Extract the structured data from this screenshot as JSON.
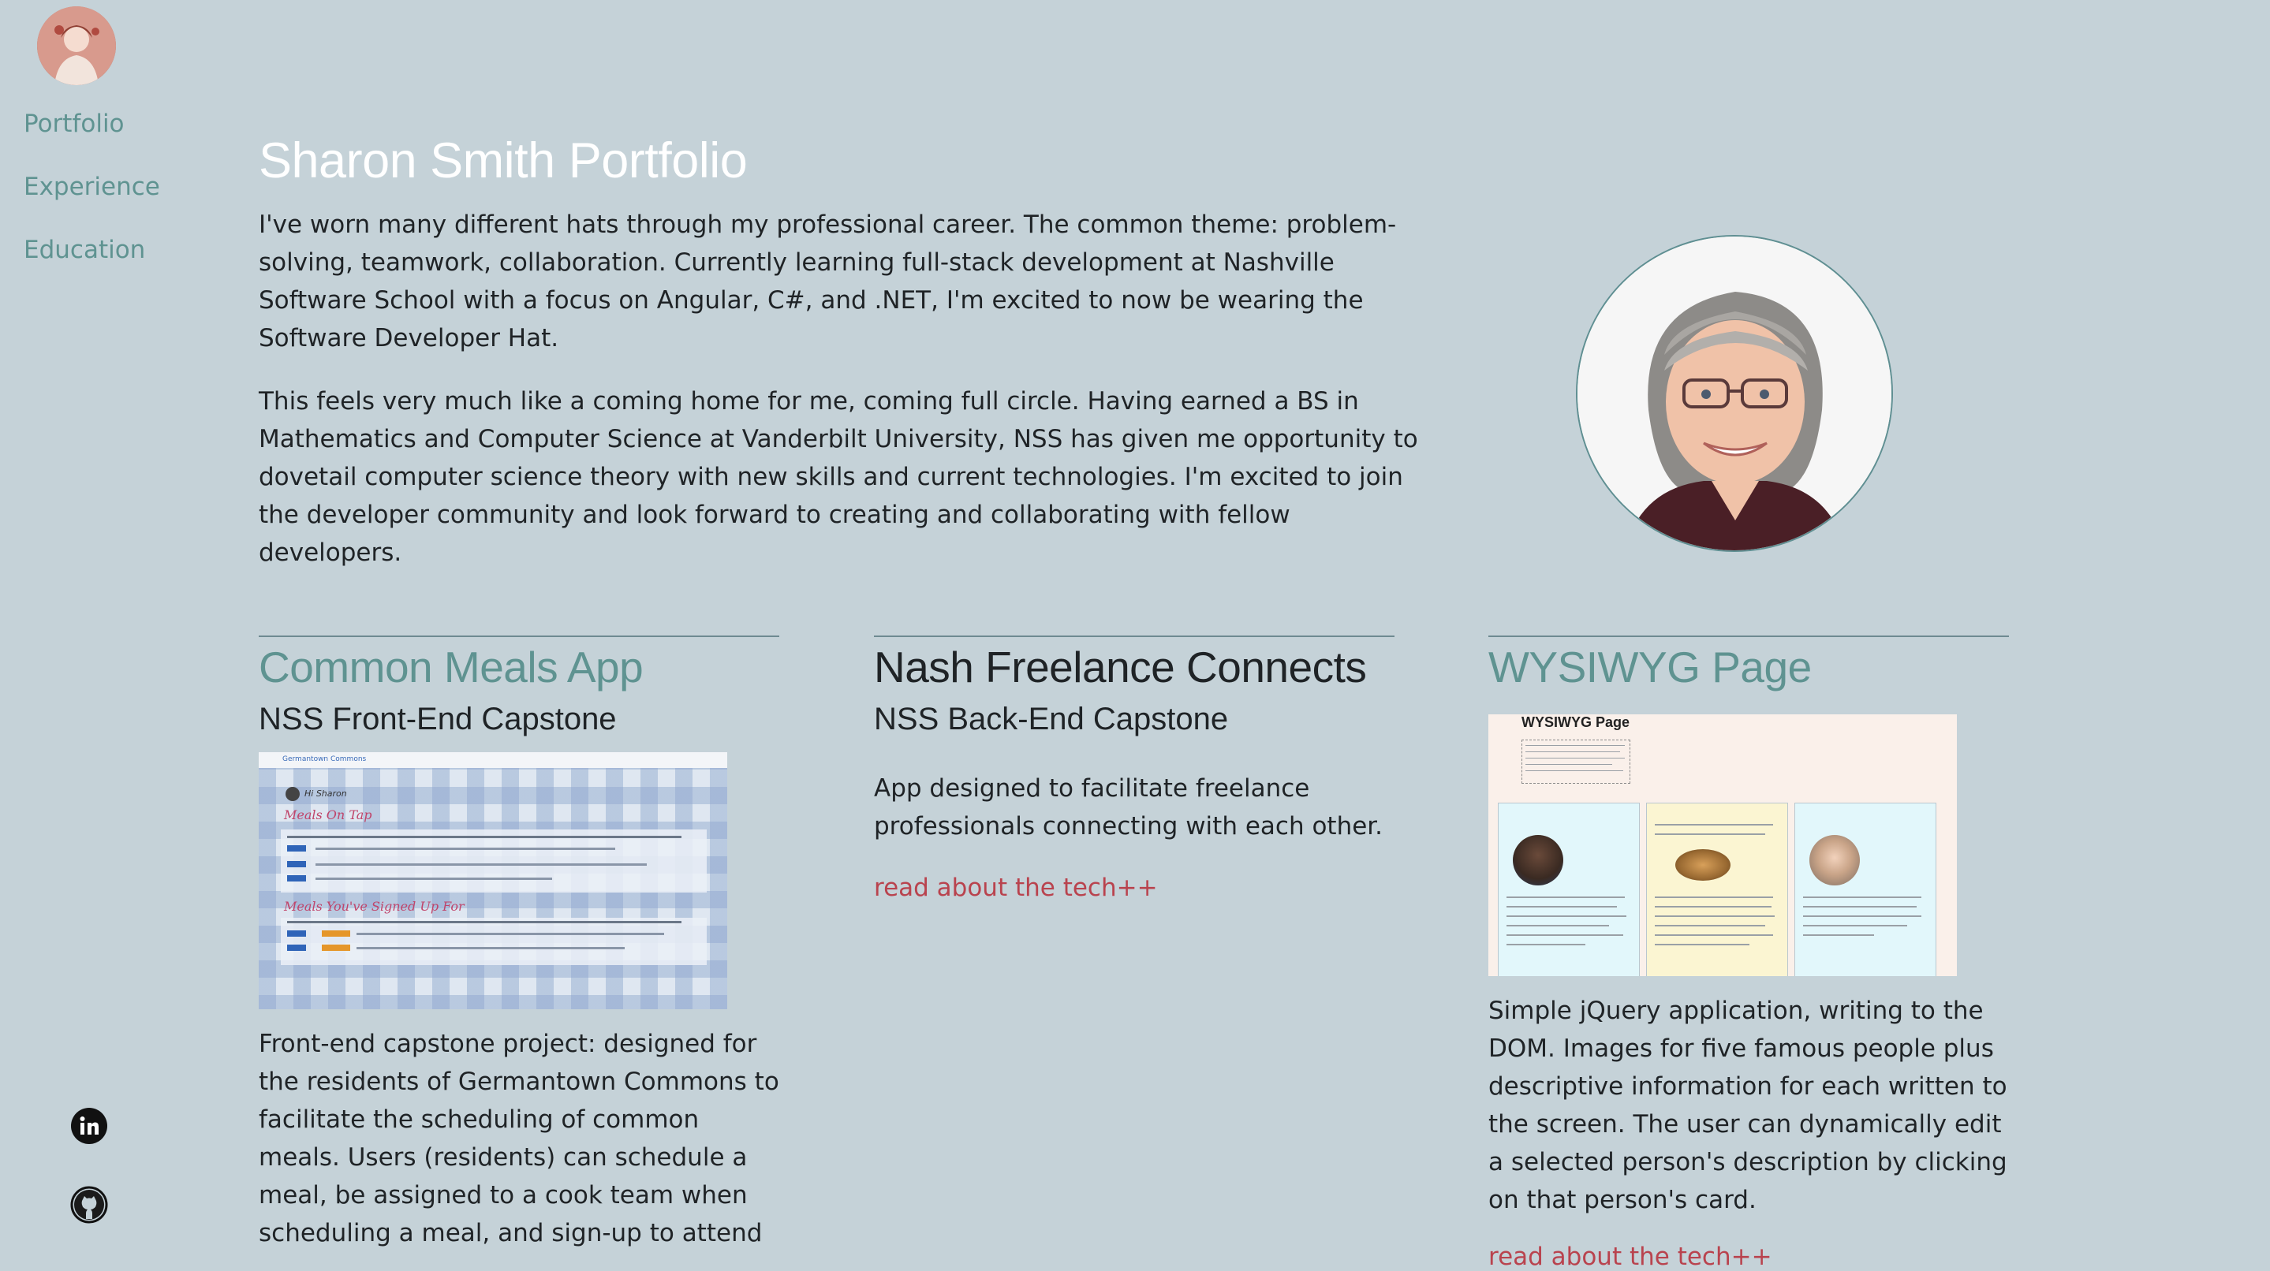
{
  "sidebar": {
    "nav": [
      {
        "label": "Portfolio"
      },
      {
        "label": "Experience"
      },
      {
        "label": "Education"
      }
    ],
    "social": [
      "linkedin-icon",
      "github-icon"
    ]
  },
  "main": {
    "title": "Sharon Smith Portfolio",
    "intro": [
      "I've worn many different hats through my professional career. The common theme: problem-solving, teamwork, collaboration. Currently learning full-stack development at Nashville Software School with a focus on Angular, C#, and .NET, I'm excited to now be wearing the Software Developer Hat.",
      "This feels very much like a coming home for me, coming full circle. Having earned a BS in Mathematics and Computer Science at Vanderbilt University, NSS has given me opportunity to dovetail computer science theory with new skills and current technologies. I'm excited to join the developer community and look forward to creating and collaborating with fellow developers."
    ]
  },
  "projects": [
    {
      "title": "Common Meals App",
      "subtitle": "NSS Front-End Capstone",
      "description": "Front-end capstone project: designed for the residents of Germantown Commons to facilitate the scheduling of common meals. Users (residents) can schedule a meal, be assigned to a cook team when scheduling a meal, and sign-up to attend"
    },
    {
      "title": "Nash Freelance Connects",
      "subtitle": "NSS Back-End Capstone",
      "description": "App designed to facilitate freelance professionals connecting with each other.",
      "link": "read about the tech++"
    },
    {
      "title": "WYSIWYG Page",
      "screenshot_header": "WYSIWYG Page",
      "description": "Simple jQuery application, writing to the DOM. Images for five famous people plus descriptive information for each written to the screen. The user can dynamically edit a selected person's description by clicking on that person's card.",
      "link": "read about the tech++"
    }
  ],
  "screenshots": {
    "meals": {
      "header_title": "Germantown Commons",
      "greeting": "Hi Sharon",
      "section_1": "Meals On Tap",
      "section_2": "Meals You've Signed Up For"
    }
  },
  "colors": {
    "background": "#c5d2d8",
    "link": "#5f9391",
    "accent_link": "#b9434e",
    "title": "#ffffff"
  }
}
